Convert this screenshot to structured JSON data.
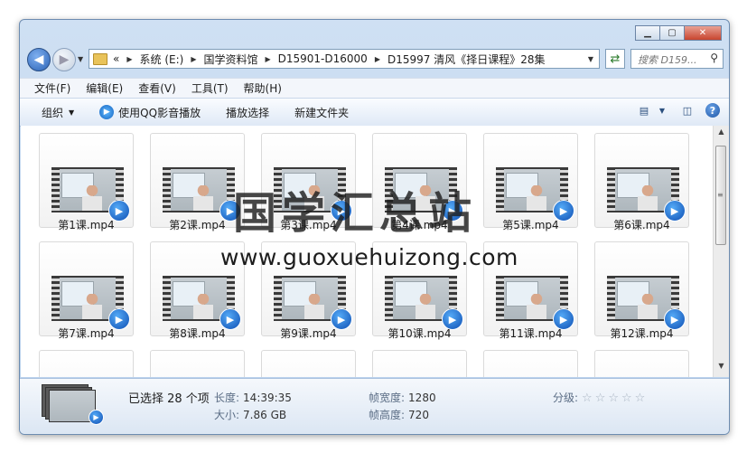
{
  "window": {
    "caption_buttons": [
      "minimize",
      "maximize",
      "close"
    ],
    "close_glyph": "✕"
  },
  "address": {
    "overflow": "«",
    "crumbs": [
      "系统 (E:)",
      "国学资料馆",
      "D15901-D16000",
      "D15997 清风《择日课程》28集"
    ]
  },
  "search": {
    "placeholder": "搜索 D159..."
  },
  "menu": [
    "文件(F)",
    "编辑(E)",
    "查看(V)",
    "工具(T)",
    "帮助(H)"
  ],
  "toolbar": {
    "organize": "组织",
    "play_with_qq": "使用QQ影音播放",
    "play_selection": "播放选择",
    "new_folder": "新建文件夹"
  },
  "files": [
    "第1课.mp4",
    "第2课.mp4",
    "第3课.mp4",
    "第4课.mp4",
    "第5课.mp4",
    "第6课.mp4",
    "第7课.mp4",
    "第8课.mp4",
    "第9课.mp4",
    "第10课.mp4",
    "第11课.mp4",
    "第12课.mp4"
  ],
  "watermark": {
    "cn": "国学汇总站",
    "en": "www.guoxuehuizong.com"
  },
  "details": {
    "selected": "已选择 28 个项",
    "length_label": "长度:",
    "length_value": "14:39:35",
    "size_label": "大小:",
    "size_value": "7.86 GB",
    "frame_width_label": "帧宽度:",
    "frame_width_value": "1280",
    "frame_height_label": "帧高度:",
    "frame_height_value": "720",
    "rating_label": "分级:",
    "rating_stars": "☆☆☆☆☆"
  }
}
